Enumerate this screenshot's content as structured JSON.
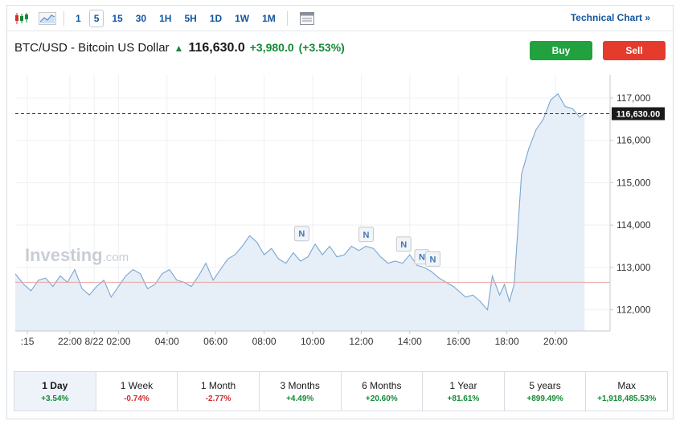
{
  "toolbar": {
    "timeframes": [
      "1",
      "5",
      "15",
      "30",
      "1H",
      "5H",
      "1D",
      "1W",
      "1M"
    ],
    "active_timeframe": "5",
    "technical_link": "Technical Chart »"
  },
  "header": {
    "pair": "BTC/USD - Bitcoin US Dollar",
    "price": "116,630.0",
    "change": "+3,980.0",
    "change_pct": "(+3.53%)",
    "buy_label": "Buy",
    "sell_label": "Sell"
  },
  "watermark": {
    "brand": "Investing",
    "suffix": ".com"
  },
  "colors": {
    "up": "#138a36",
    "down": "#d12d2d",
    "line": "#7aa6cf",
    "area": "#e6eef7",
    "buy": "#22a13f",
    "sell": "#e43b2c",
    "link": "#1256a0"
  },
  "chart_data": {
    "type": "area",
    "x_tick_labels": [
      ":15",
      "22:00",
      "8/22",
      "02:00",
      "04:00",
      "06:00",
      "08:00",
      "10:00",
      "12:00",
      "14:00",
      "16:00",
      "18:00",
      "20:00"
    ],
    "x_tick_hours": [
      -3.75,
      -2,
      -1,
      0,
      2,
      4,
      6,
      8,
      10,
      12,
      14,
      16,
      18
    ],
    "xlim": [
      -4.25,
      20.25
    ],
    "y_tick_values": [
      112000,
      113000,
      114000,
      115000,
      116000,
      117000
    ],
    "y_tick_labels": [
      "112,000",
      "113,000",
      "114,000",
      "115,000",
      "116,000",
      "117,000"
    ],
    "ylim": [
      111500,
      117550
    ],
    "current_price": 116630,
    "current_price_label": "116,630.00",
    "prev_close": 112650,
    "news_markers": [
      {
        "label": "N",
        "x": 7.55,
        "y": 113800
      },
      {
        "label": "N",
        "x": 10.2,
        "y": 113780
      },
      {
        "label": "N",
        "x": 11.75,
        "y": 113550
      },
      {
        "label": "N",
        "x": 12.5,
        "y": 113250
      },
      {
        "label": "N",
        "x": 12.95,
        "y": 113200
      }
    ],
    "series": [
      {
        "x": [
          -4.25,
          -3.9,
          -3.6,
          -3.3,
          -3.0,
          -2.7,
          -2.4,
          -2.1,
          -1.8,
          -1.5,
          -1.2,
          -0.9,
          -0.6,
          -0.3,
          0.0,
          0.3,
          0.6,
          0.9,
          1.2,
          1.5,
          1.8,
          2.1,
          2.4,
          2.7,
          3.0,
          3.3,
          3.6,
          3.9,
          4.2,
          4.5,
          4.8,
          5.1,
          5.4,
          5.7,
          6.0,
          6.3,
          6.6,
          6.9,
          7.2,
          7.5,
          7.8,
          8.1,
          8.4,
          8.7,
          9.0,
          9.3,
          9.6,
          9.9,
          10.2,
          10.5,
          10.8,
          11.1,
          11.4,
          11.7,
          12.0,
          12.3,
          12.6,
          12.9,
          13.2,
          13.5,
          13.8,
          14.1,
          14.3,
          14.6,
          14.9,
          15.2,
          15.4,
          15.7,
          15.9,
          16.1,
          16.3,
          16.6,
          16.9,
          17.2,
          17.5,
          17.8,
          18.1,
          18.4,
          18.7,
          19.0,
          19.2
        ],
        "y": [
          112850,
          112600,
          112450,
          112700,
          112750,
          112550,
          112800,
          112650,
          112950,
          112500,
          112350,
          112550,
          112700,
          112300,
          112550,
          112800,
          112950,
          112850,
          112500,
          112600,
          112850,
          112950,
          112700,
          112650,
          112550,
          112800,
          113100,
          112700,
          112950,
          113200,
          113300,
          113500,
          113750,
          113600,
          113300,
          113450,
          113200,
          113100,
          113350,
          113150,
          113250,
          113550,
          113300,
          113500,
          113250,
          113300,
          113500,
          113400,
          113500,
          113450,
          113250,
          113100,
          113150,
          113100,
          113300,
          113050,
          113000,
          112900,
          112750,
          112650,
          112550,
          112400,
          112300,
          112350,
          112200,
          112000,
          112800,
          112350,
          112600,
          112200,
          112600,
          115200,
          115800,
          116250,
          116500,
          116950,
          117100,
          116800,
          116750,
          116550,
          116630
        ]
      }
    ]
  }
}
